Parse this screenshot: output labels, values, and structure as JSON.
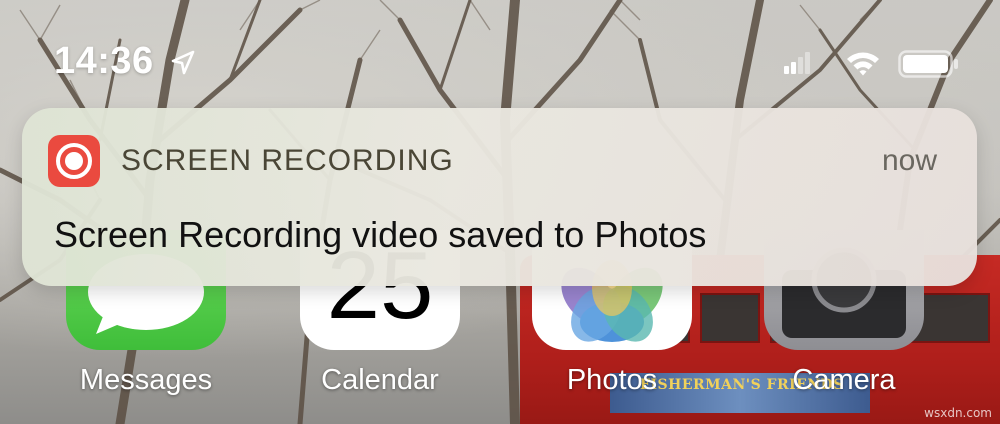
{
  "status_bar": {
    "time": "14:36",
    "icons": [
      "location-arrow-icon",
      "cellular-signal-icon",
      "wifi-icon",
      "battery-icon"
    ]
  },
  "notification": {
    "app_name": "SCREEN RECORDING",
    "time": "now",
    "message": "Screen Recording video saved to Photos",
    "icon": "screen-record-icon",
    "accent_color": "#ea4a3f"
  },
  "apps": [
    {
      "label": "Messages",
      "icon": "messages-icon"
    },
    {
      "label": "Calendar",
      "icon": "calendar-icon",
      "date": "25"
    },
    {
      "label": "Photos",
      "icon": "photos-icon"
    },
    {
      "label": "Camera",
      "icon": "camera-icon"
    }
  ],
  "wallpaper": {
    "ad_text": "FISHERMAN'S FRIENDS",
    "watermark": "wsxdn.com"
  }
}
